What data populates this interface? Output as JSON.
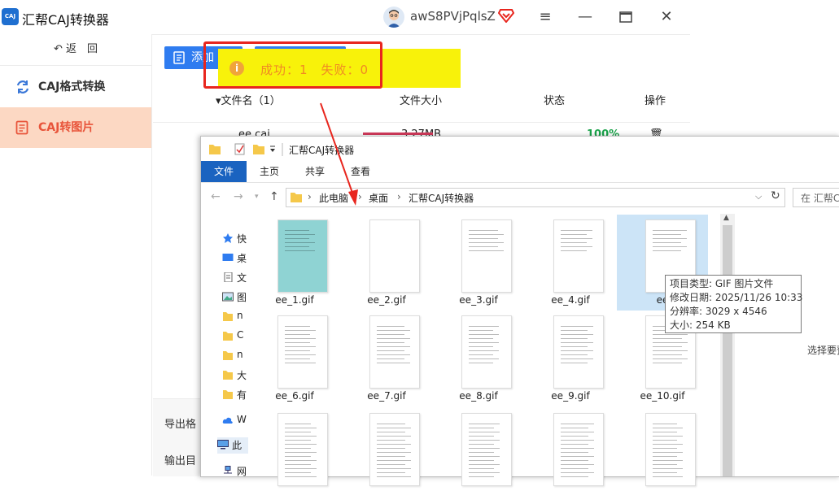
{
  "app": {
    "logo_text": "CAJ",
    "title": "汇帮CAJ转换器",
    "user_name": "awS8PVjPqlsZ",
    "sidebar": {
      "back_label": "返　回",
      "items": [
        {
          "label": "CAJ格式转换",
          "active": false
        },
        {
          "label": "CAJ转图片",
          "active": true
        }
      ]
    },
    "toolbar": {
      "add_file_label": "添加"
    },
    "table": {
      "headers": {
        "name": "▾文件名（1）",
        "size": "文件大小",
        "status": "状态",
        "ops": "操作"
      },
      "row": {
        "name": "ee.caj",
        "size": "3.27MB",
        "progress": 1.0,
        "progress_text": "100%",
        "delete_icon": "trash-icon"
      }
    },
    "bottom": {
      "export_format_label": "导出格",
      "output_dir_label": "输出目"
    },
    "accent": "#2f7cf0",
    "active_color": "#e8543a"
  },
  "toast": {
    "text": "成功：1　失败：0",
    "icon": "info-icon"
  },
  "explorer": {
    "title": "汇帮CAJ转换器",
    "ribbon_tabs": [
      "文件",
      "主页",
      "共享",
      "查看"
    ],
    "path": [
      "此电脑",
      "桌面",
      "汇帮CAJ转换器"
    ],
    "search_placeholder": "在 汇帮C",
    "nav_items": [
      {
        "label": "快",
        "icon": "star-icon"
      },
      {
        "label": "桌",
        "icon": "desktop-icon"
      },
      {
        "label": "文",
        "icon": "document-icon"
      },
      {
        "label": "图",
        "icon": "picture-icon"
      },
      {
        "label": "n",
        "icon": "folder-icon"
      },
      {
        "label": "C",
        "icon": "folder-icon"
      },
      {
        "label": "n",
        "icon": "folder-icon"
      },
      {
        "label": "大",
        "icon": "folder-icon"
      },
      {
        "label": "有",
        "icon": "folder-icon"
      },
      {
        "label": "W",
        "icon": "cloud-icon"
      },
      {
        "label": "此",
        "icon": "computer-icon"
      },
      {
        "label": "网",
        "icon": "network-icon"
      }
    ],
    "files": [
      {
        "name": "ee_1.gif"
      },
      {
        "name": "ee_2.gif"
      },
      {
        "name": "ee_3.gif"
      },
      {
        "name": "ee_4.gif"
      },
      {
        "name": "ee"
      },
      {
        "name": "ee_6.gif"
      },
      {
        "name": "ee_7.gif"
      },
      {
        "name": "ee_8.gif"
      },
      {
        "name": "ee_9.gif"
      },
      {
        "name": "ee_10.gif"
      },
      {
        "name": ""
      },
      {
        "name": ""
      },
      {
        "name": ""
      },
      {
        "name": ""
      },
      {
        "name": ""
      }
    ],
    "tooltip": [
      "项目类型: GIF 图片文件",
      "修改日期: 2025/11/26 10:33",
      "分辨率: 3029 x 4546",
      "大小: 254 KB"
    ],
    "preview_text": "选择要预"
  }
}
